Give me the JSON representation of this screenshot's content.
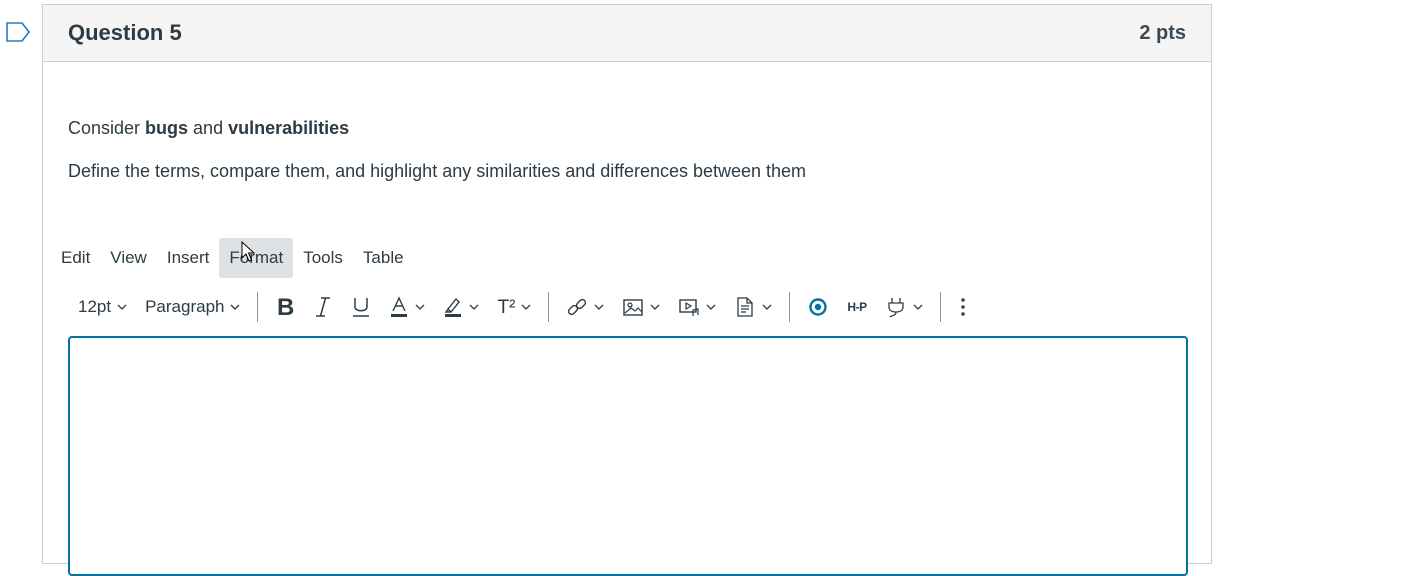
{
  "question": {
    "title": "Question 5",
    "points": "2 pts",
    "prompt_parts": [
      "Consider ",
      "bugs",
      " and ",
      "vulnerabilities"
    ],
    "prompt_line2": "Define the terms, compare them, and highlight any similarities and differences between them"
  },
  "editor": {
    "menu": [
      "Edit",
      "View",
      "Insert",
      "Format",
      "Tools",
      "Table"
    ],
    "active_menu": "Format",
    "font_size": "12pt",
    "block_format": "Paragraph",
    "superscript_label": "T²",
    "h5p_label": "H-P",
    "accent_color": "#0770a3"
  },
  "icons": [
    "flag-icon",
    "bold-icon",
    "italic-icon",
    "underline-icon",
    "text-color-icon",
    "highlight-icon",
    "superscript-icon",
    "link-icon",
    "image-icon",
    "media-icon",
    "document-icon",
    "apps-icon",
    "h5p-icon",
    "plugin-icon",
    "more-icon",
    "chevron-down-icon",
    "mouse-cursor-icon"
  ]
}
